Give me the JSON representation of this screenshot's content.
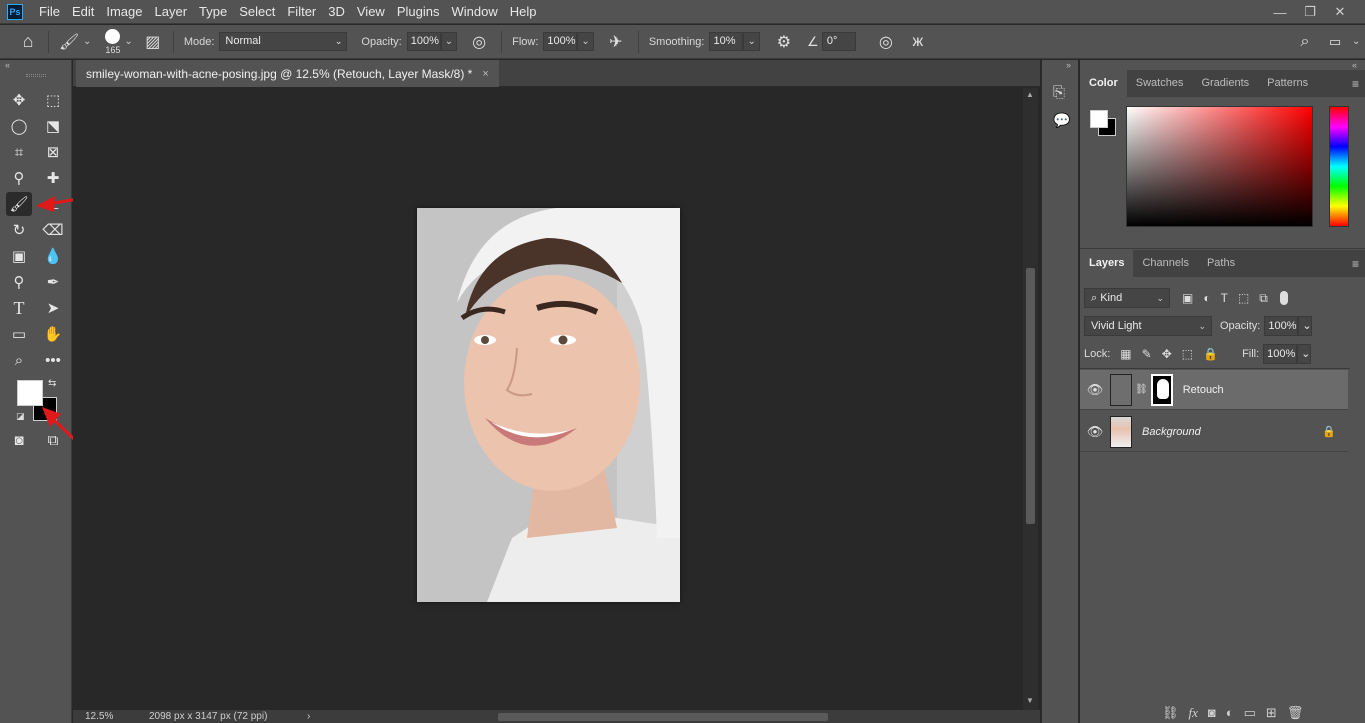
{
  "menubar": {
    "logo": "Ps",
    "items": [
      "File",
      "Edit",
      "Image",
      "Layer",
      "Type",
      "Select",
      "Filter",
      "3D",
      "View",
      "Plugins",
      "Window",
      "Help"
    ],
    "window_controls": [
      "—",
      "❐",
      "✕"
    ]
  },
  "options": {
    "brush_size": "165",
    "mode_label": "Mode:",
    "mode_value": "Normal",
    "opacity_label": "Opacity:",
    "opacity_value": "100%",
    "flow_label": "Flow:",
    "flow_value": "100%",
    "smoothing_label": "Smoothing:",
    "smoothing_value": "10%",
    "angle_value": "0°"
  },
  "document": {
    "tab_title": "smiley-woman-with-acne-posing.jpg @ 12.5% (Retouch, Layer Mask/8) *",
    "tab_close": "×"
  },
  "status": {
    "zoom": "12.5%",
    "dimensions": "2098 px x 3147 px (72 ppi)",
    "arrow": "›"
  },
  "color_panel": {
    "tabs": [
      "Color",
      "Swatches",
      "Gradients",
      "Patterns"
    ],
    "foreground": "#ffffff",
    "background": "#000000"
  },
  "layers_panel": {
    "tabs": [
      "Layers",
      "Channels",
      "Paths"
    ],
    "filter_label": "Kind",
    "blend_mode": "Vivid Light",
    "opacity_label": "Opacity:",
    "opacity_value": "100%",
    "lock_label": "Lock:",
    "fill_label": "Fill:",
    "fill_value": "100%",
    "layers": [
      {
        "name": "Retouch",
        "selected": true
      },
      {
        "name": "Background",
        "locked": true
      }
    ],
    "footer_icons": [
      "link-icon",
      "fx-icon",
      "mask-icon",
      "adjustment-icon",
      "folder-icon",
      "new-layer-icon",
      "trash-icon"
    ]
  }
}
